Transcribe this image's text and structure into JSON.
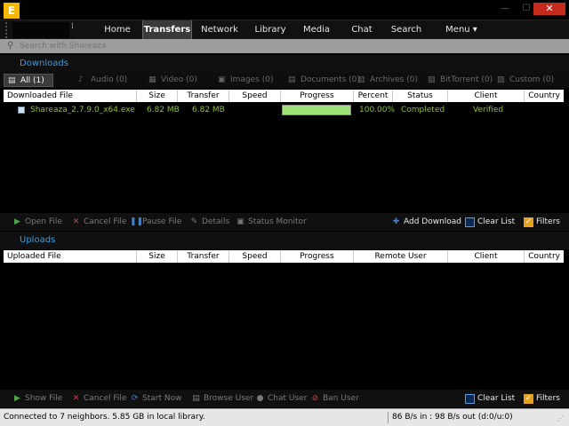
{
  "window": {
    "logo_letter": "E",
    "minimize": "—",
    "maximize": "☐",
    "close": "✕"
  },
  "nav": {
    "handle": "⁞",
    "items": [
      {
        "label": "Home",
        "active": false
      },
      {
        "label": "Transfers",
        "active": true
      },
      {
        "label": "Network",
        "active": false
      },
      {
        "label": "Library",
        "active": false
      },
      {
        "label": "Media",
        "active": false
      },
      {
        "label": "Chat",
        "active": false
      },
      {
        "label": "Search",
        "active": false
      },
      {
        "label": "Menu ▾",
        "active": false
      }
    ]
  },
  "search": {
    "placeholder": "Search with Shareaza"
  },
  "downloads": {
    "title": "Downloads",
    "filters": [
      {
        "label": "All (1)",
        "icon": "▤",
        "active": true
      },
      {
        "label": "Audio (0)",
        "icon": "♪",
        "active": false
      },
      {
        "label": "Video (0)",
        "icon": "▦",
        "active": false
      },
      {
        "label": "Images (0)",
        "icon": "▣",
        "active": false
      },
      {
        "label": "Documents (0)",
        "icon": "▤",
        "active": false
      },
      {
        "label": "Archives (0)",
        "icon": "▥",
        "active": false
      },
      {
        "label": "BitTorrent (0)",
        "icon": "▧",
        "active": false
      },
      {
        "label": "Custom (0)",
        "icon": "▨",
        "active": false
      }
    ],
    "columns": [
      "Downloaded File",
      "Size",
      "Transfer",
      "Speed",
      "Progress",
      "Percent",
      "Status",
      "Client",
      "Country"
    ],
    "rows": [
      {
        "file": "Shareaza_2.7.9.0_x64.exe",
        "size": "6.82 MB",
        "transfer": "6.82 MB",
        "speed": "",
        "progress": 1.0,
        "percent": "100.00%",
        "status": "Completed",
        "client": "Verified",
        "country": ""
      }
    ],
    "toolbar": {
      "open_file": "Open File",
      "cancel_file": "Cancel File",
      "pause_file": "Pause File",
      "details": "Details",
      "status_monitor": "Status Monitor",
      "add_download": "Add Download",
      "clear_list": "Clear List",
      "filters": "Filters"
    }
  },
  "uploads": {
    "title": "Uploads",
    "columns": [
      "Uploaded File",
      "Size",
      "Transfer",
      "Speed",
      "Progress",
      "Remote User",
      "Client",
      "Country"
    ],
    "toolbar": {
      "show_file": "Show File",
      "cancel_file": "Cancel File",
      "start_now": "Start Now",
      "browse_user": "Browse User",
      "chat_user": "Chat User",
      "ban_user": "Ban User",
      "clear_list": "Clear List",
      "filters": "Filters"
    }
  },
  "status": {
    "left": "Connected to 7 neighbors.  5.85 GB in local library.",
    "right": "86 B/s in : 98 B/s out  (d:0/u:0)"
  },
  "colors": {
    "accent_blue": "#3d9ad8",
    "completed_green": "#8dc03c",
    "progress_green": "#9ee27a",
    "close_red": "#c42b1c",
    "logo_yellow": "#f5b800"
  }
}
